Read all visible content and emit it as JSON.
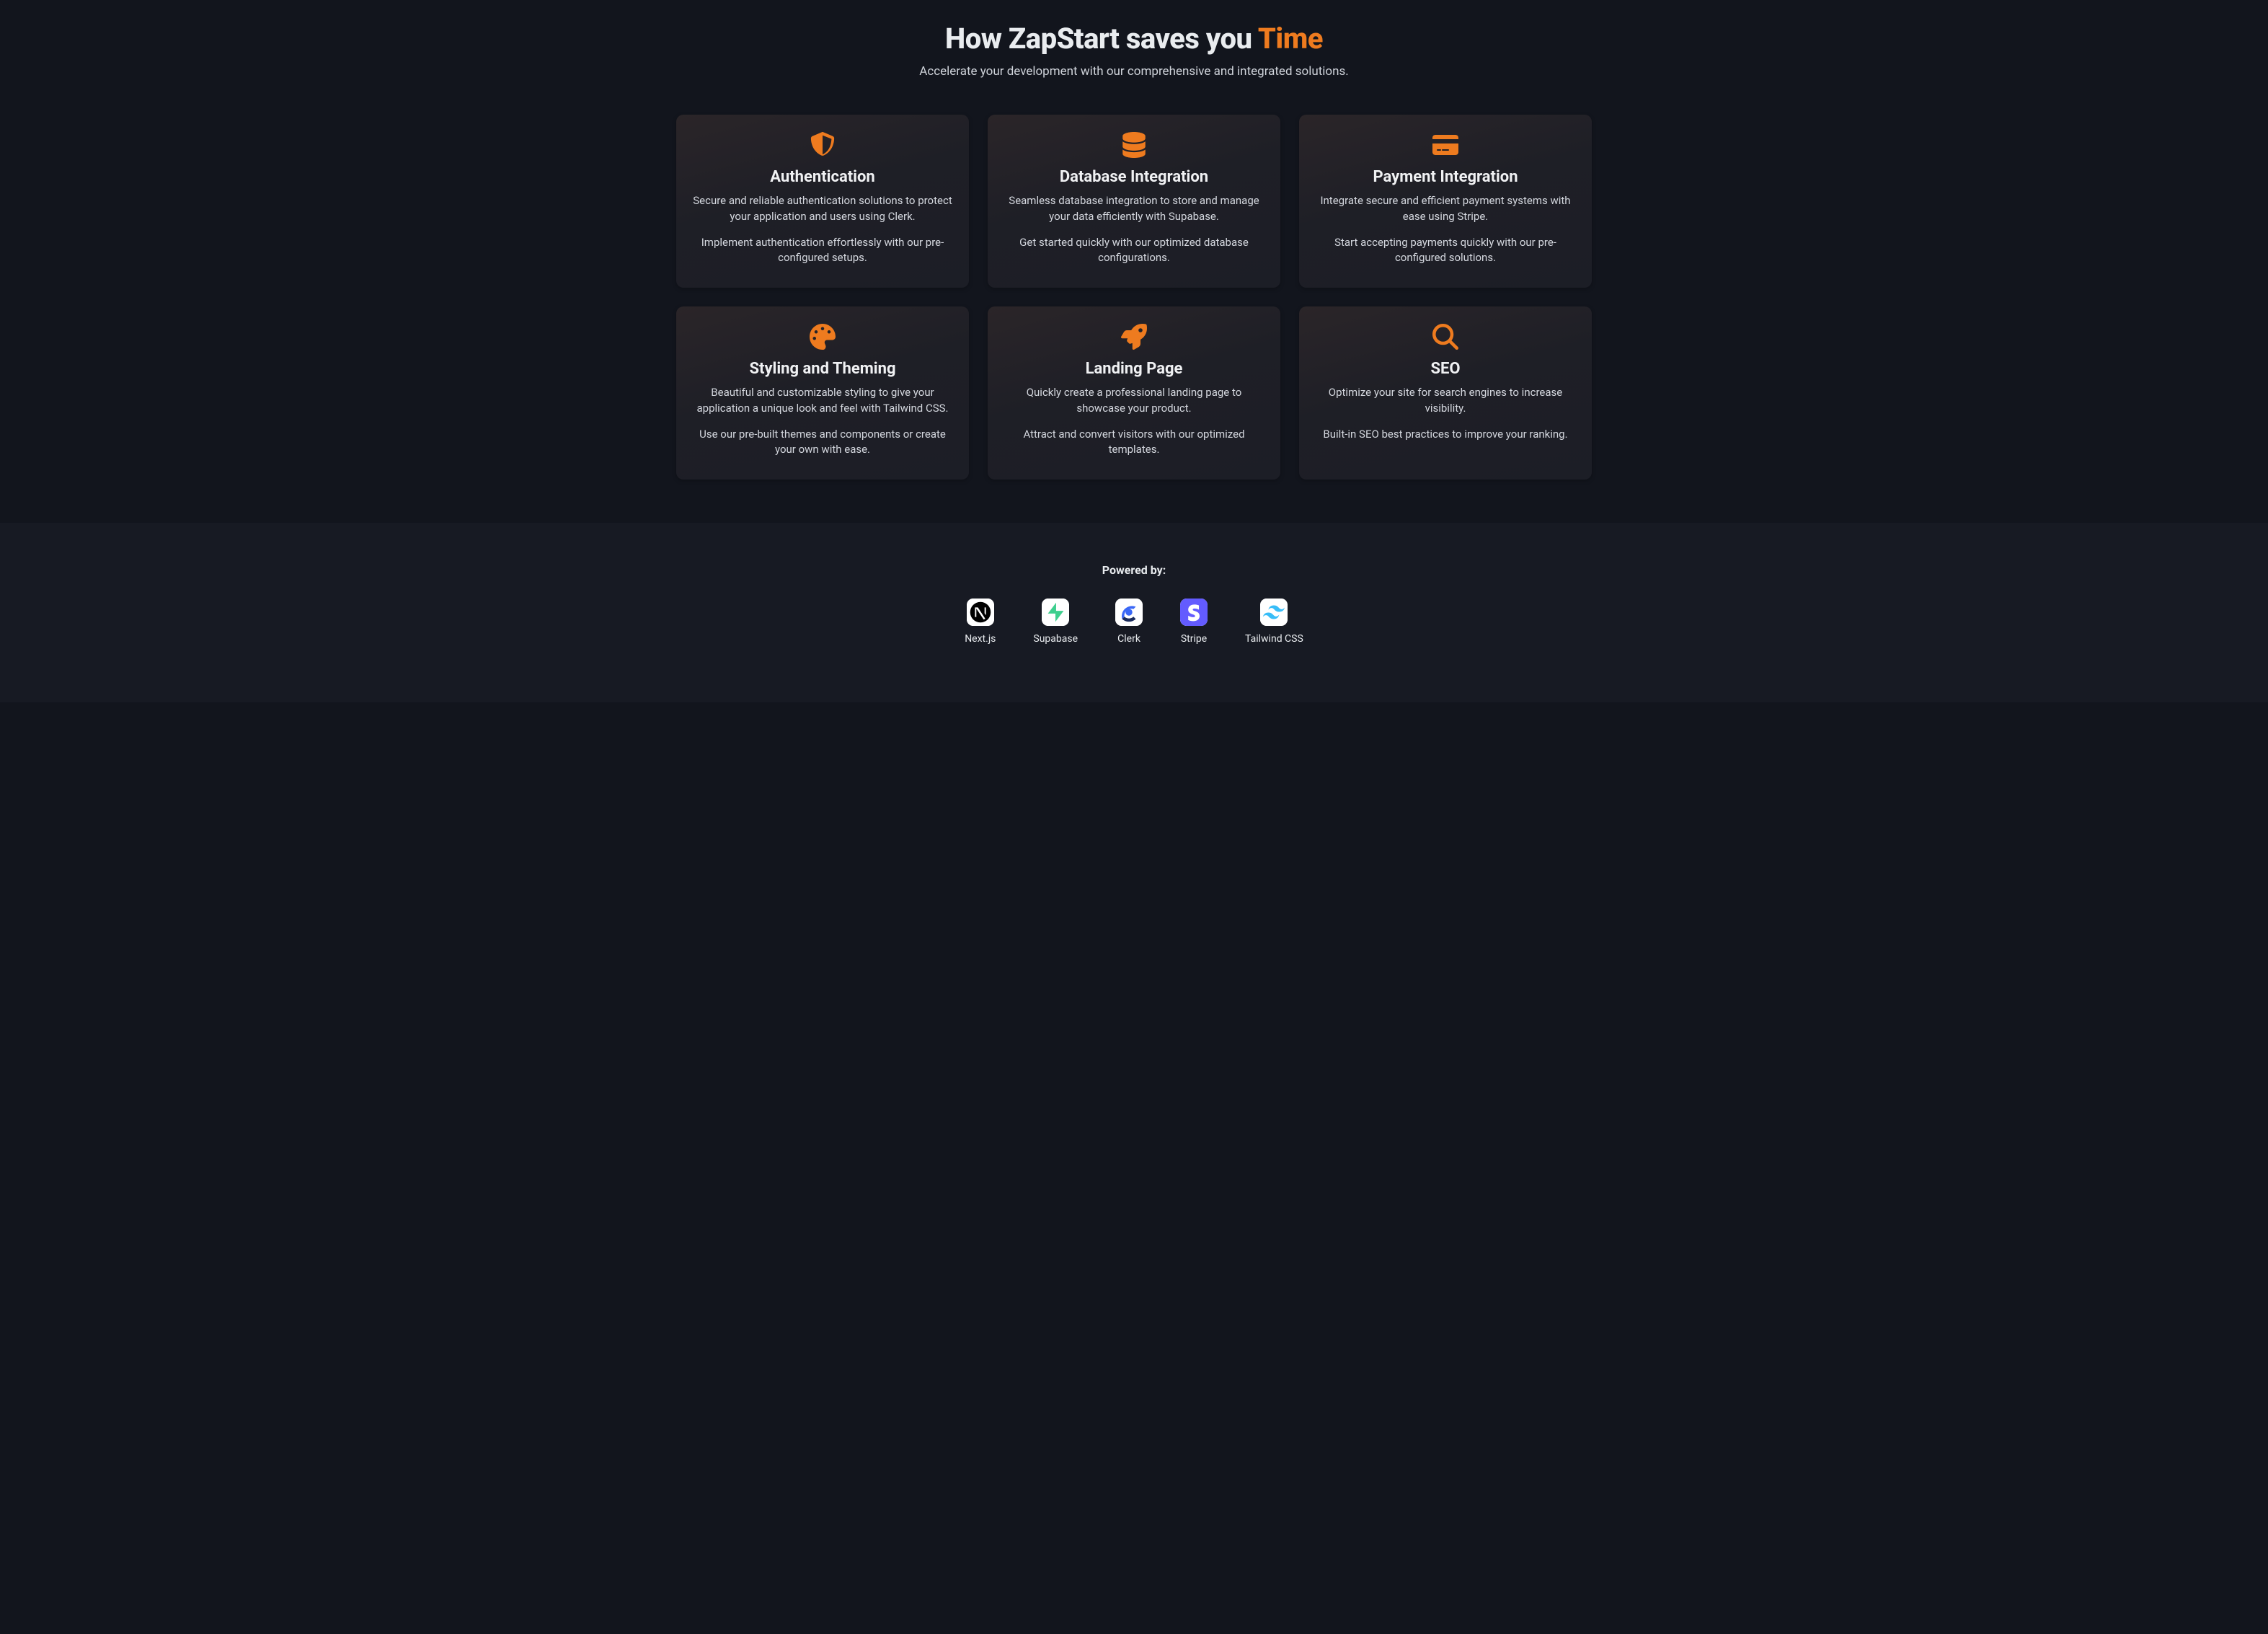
{
  "heading_prefix": "How ZapStart saves you ",
  "heading_accent": "Time",
  "subheading": "Accelerate your development with our comprehensive and integrated solutions.",
  "cards": [
    {
      "icon": "shield",
      "title": "Authentication",
      "desc1": "Secure and reliable authentication solutions to protect your application and users using Clerk.",
      "desc2": "Implement authentication effortlessly with our pre-configured setups."
    },
    {
      "icon": "database",
      "title": "Database Integration",
      "desc1": "Seamless database integration to store and manage your data efficiently with Supabase.",
      "desc2": "Get started quickly with our optimized database configurations."
    },
    {
      "icon": "credit-card",
      "title": "Payment Integration",
      "desc1": "Integrate secure and efficient payment systems with ease using Stripe.",
      "desc2": "Start accepting payments quickly with our pre-configured solutions."
    },
    {
      "icon": "palette",
      "title": "Styling and Theming",
      "desc1": "Beautiful and customizable styling to give your application a unique look and feel with Tailwind CSS.",
      "desc2": "Use our pre-built themes and components or create your own with ease."
    },
    {
      "icon": "rocket",
      "title": "Landing Page",
      "desc1": "Quickly create a professional landing page to showcase your product.",
      "desc2": "Attract and convert visitors with our optimized templates."
    },
    {
      "icon": "search",
      "title": "SEO",
      "desc1": "Optimize your site for search engines to increase visibility.",
      "desc2": "Built-in SEO best practices to improve your ranking."
    }
  ],
  "powered_by_label": "Powered by:",
  "techs": [
    {
      "name": "Next.js",
      "icon": "nextjs"
    },
    {
      "name": "Supabase",
      "icon": "supabase"
    },
    {
      "name": "Clerk",
      "icon": "clerk"
    },
    {
      "name": "Stripe",
      "icon": "stripe"
    },
    {
      "name": "Tailwind CSS",
      "icon": "tailwind"
    }
  ],
  "colors": {
    "accent": "#ee7b1f"
  }
}
